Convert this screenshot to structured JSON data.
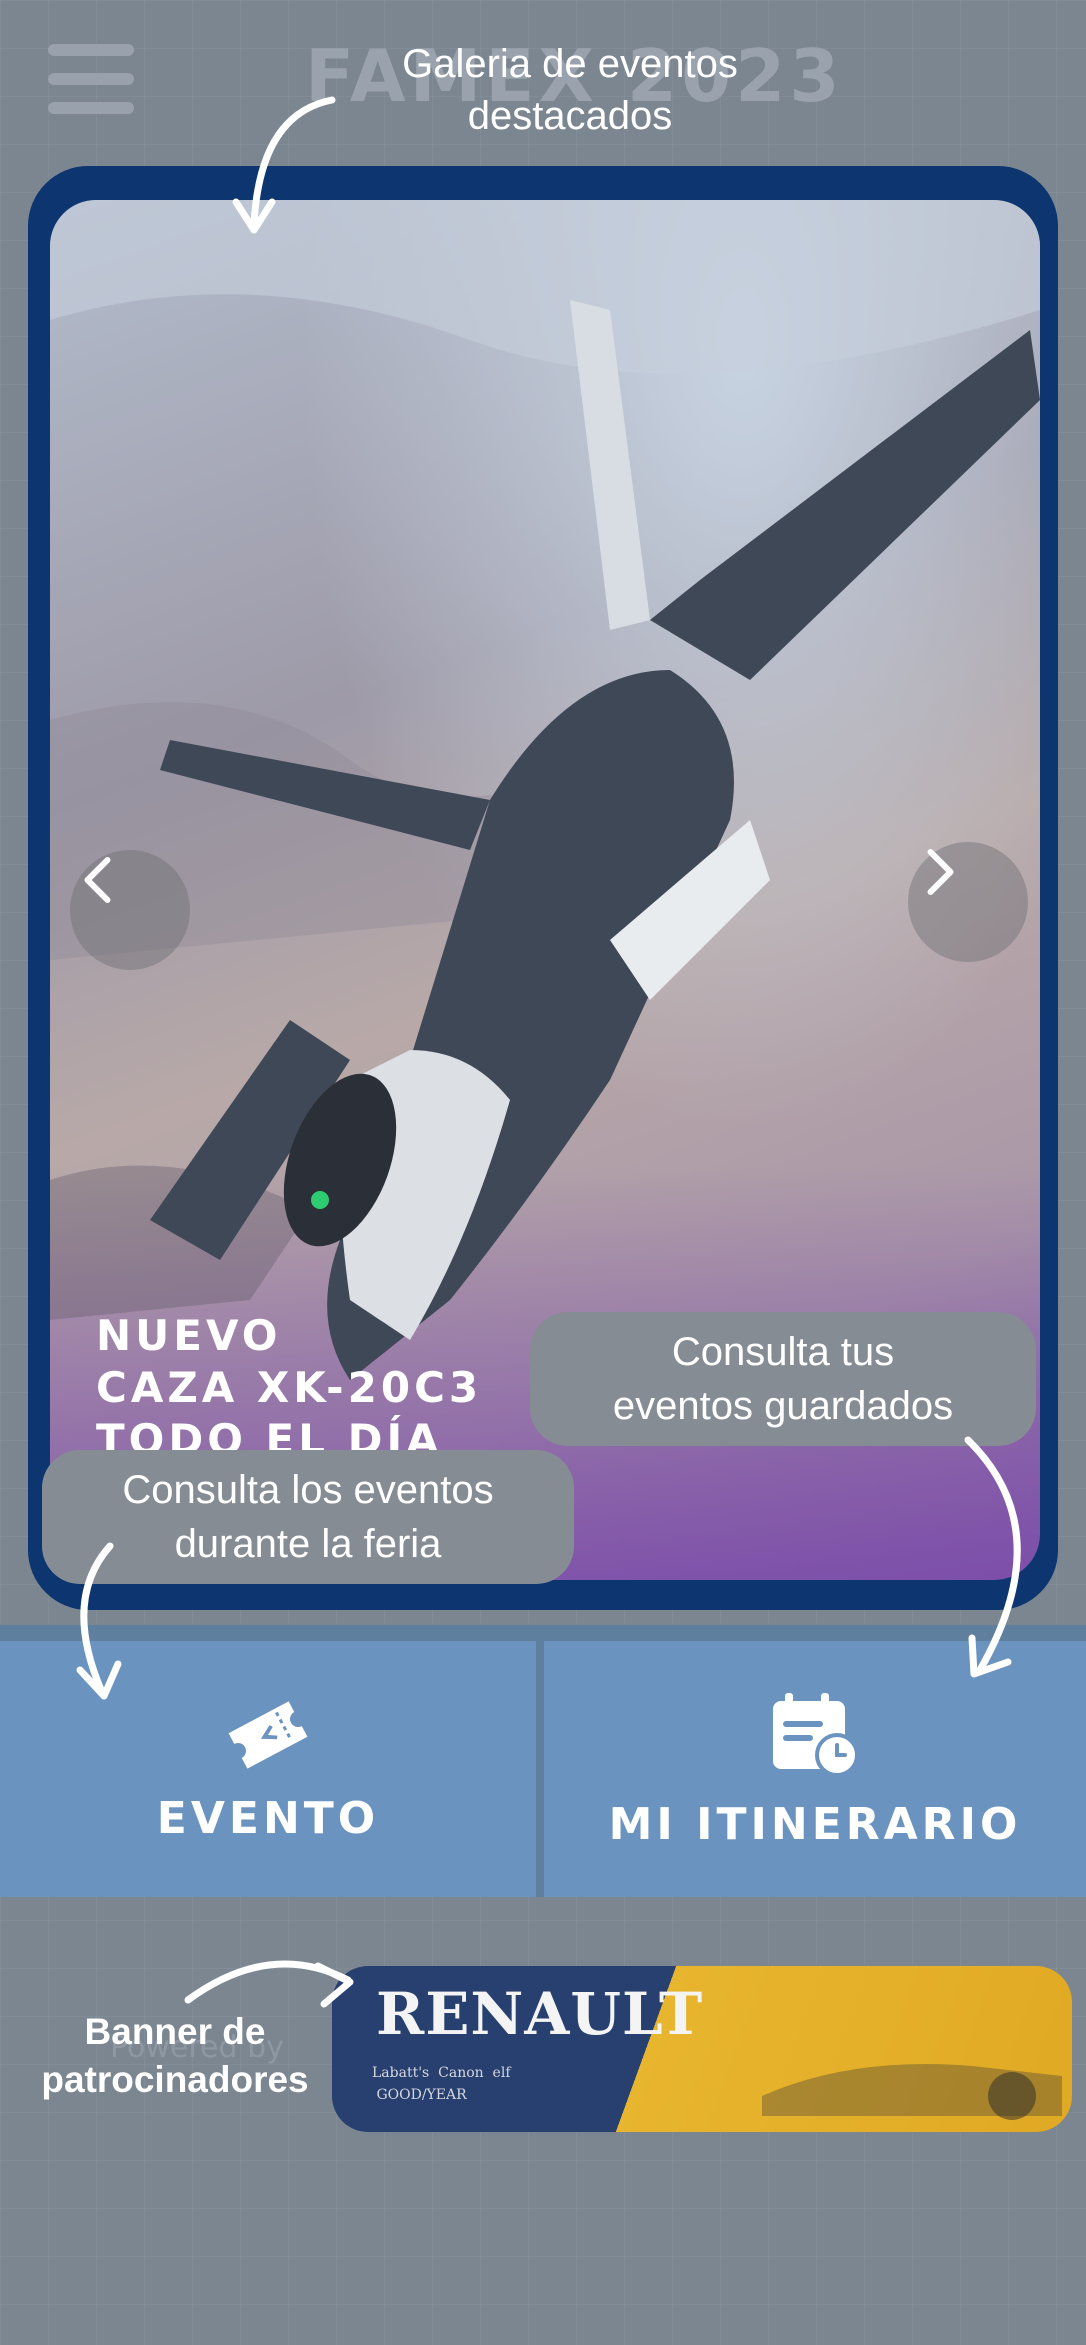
{
  "app": {
    "brand": "FAMEX 2023",
    "menu_icon": "hamburger-icon"
  },
  "gallery": {
    "slide_title": "NUEVO\nCAZA XK-20C3\nTODO EL DÍA",
    "prev_icon": "chevron-left-icon",
    "next_icon": "chevron-right-icon"
  },
  "tiles": [
    {
      "label": "EVENTO",
      "icon": "ticket-icon"
    },
    {
      "label": "MI ITINERARIO",
      "icon": "calendar-clock-icon"
    }
  ],
  "sponsors": {
    "powered_by": "Powered by",
    "banner_brand": "RENAULT",
    "banner_small": "Labatt's  Canon  elf\n GOOD/YEAR"
  },
  "tutorial": {
    "gallery_hint": "Galeria de eventos\ndestacados",
    "itinerary_hint": "Consulta tus\neventos guardados",
    "events_hint": "Consulta los eventos\ndurante la feria",
    "banner_hint": "Banner de\npatrocinadores"
  },
  "colors": {
    "card_navy": "#0d3570",
    "tile_blue": "#6b93c0",
    "overlay_gray": "#868c94"
  }
}
